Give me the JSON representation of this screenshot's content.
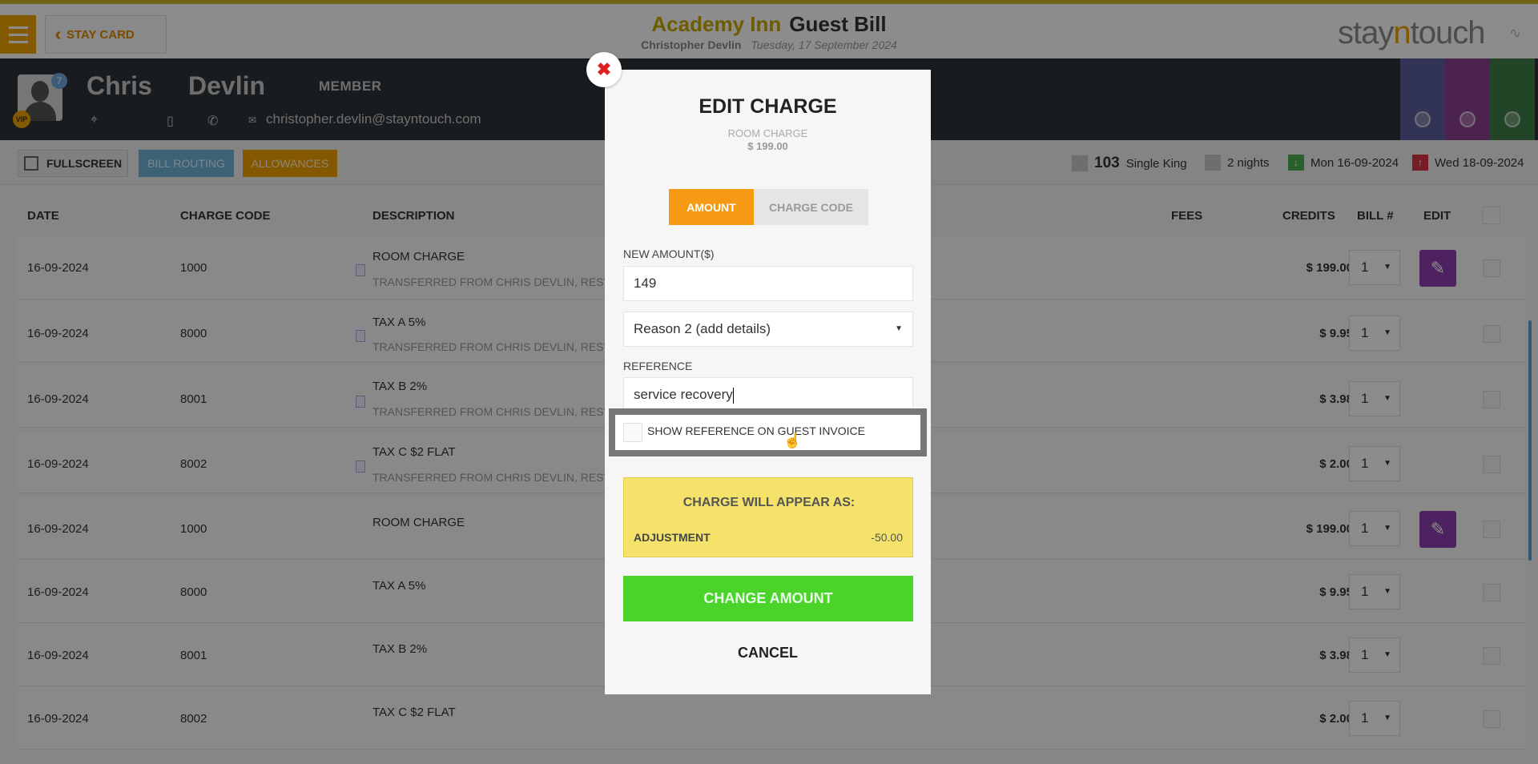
{
  "header": {
    "menu_icon": "hamburger-icon",
    "back_label": "STAY CARD",
    "hotel": "Academy Inn",
    "page": "Guest Bill",
    "guest_name": "Christopher Devlin",
    "date": "Tuesday, 17 September 2024",
    "brand_prefix": "stay",
    "brand_accent": "n",
    "brand_suffix": "touch",
    "accent_color": "#f0a500"
  },
  "guest": {
    "first_name": "Chris",
    "last_name": "Devlin",
    "status": "MEMBER",
    "avatar_badge": "7",
    "vip": "VIP",
    "email": "christopher.devlin@stayntouch.com"
  },
  "toolbar": {
    "fullscreen": "FULLSCREEN",
    "bill_routing": "BILL ROUTING",
    "allowances": "ALLOWANCES",
    "room_number": "103",
    "room_type": "Single King",
    "nights": "2 nights",
    "arrival": "Mon 16-09-2024",
    "departure": "Wed 18-09-2024"
  },
  "table": {
    "headers": {
      "date": "DATE",
      "charge_code": "CHARGE CODE",
      "description": "DESCRIPTION",
      "fees": "FEES",
      "credits": "CREDITS",
      "bill": "BILL #",
      "edit": "EDIT"
    },
    "rows": [
      {
        "date": "16-09-2024",
        "code": "1000",
        "desc": "ROOM CHARGE",
        "desc2": "TRANSFERRED FROM CHRIS DEVLIN, RESV #",
        "fees": "$ 199.00",
        "bill": "1"
      },
      {
        "date": "16-09-2024",
        "code": "8000",
        "desc": "TAX A 5%",
        "desc2": "TRANSFERRED FROM CHRIS DEVLIN, RESV #",
        "fees": "$ 9.95",
        "bill": "1"
      },
      {
        "date": "16-09-2024",
        "code": "8001",
        "desc": "TAX B 2%",
        "desc2": "TRANSFERRED FROM CHRIS DEVLIN, RESV #",
        "fees": "$ 3.98",
        "bill": "1"
      },
      {
        "date": "16-09-2024",
        "code": "8002",
        "desc": "TAX C $2 FLAT",
        "desc2": "TRANSFERRED FROM CHRIS DEVLIN, RESV #",
        "fees": "$ 2.00",
        "bill": "1"
      },
      {
        "date": "16-09-2024",
        "code": "1000",
        "desc": "ROOM CHARGE",
        "desc2": "",
        "fees": "$ 199.00",
        "bill": "1"
      },
      {
        "date": "16-09-2024",
        "code": "8000",
        "desc": "TAX A 5%",
        "desc2": "",
        "fees": "$ 9.95",
        "bill": "1"
      },
      {
        "date": "16-09-2024",
        "code": "8001",
        "desc": "TAX B 2%",
        "desc2": "",
        "fees": "$ 3.98",
        "bill": "1"
      },
      {
        "date": "16-09-2024",
        "code": "8002",
        "desc": "TAX C $2 FLAT",
        "desc2": "",
        "fees": "$ 2.00",
        "bill": "1"
      }
    ]
  },
  "modal": {
    "title": "EDIT CHARGE",
    "charge_name": "ROOM CHARGE",
    "charge_amount": "$ 199.00",
    "tab_amount": "AMOUNT",
    "tab_code": "CHARGE CODE",
    "new_amount_label": "NEW AMOUNT($)",
    "new_amount_value": "149",
    "reason_selected": "Reason 2 (add details)",
    "reference_label": "REFERENCE",
    "reference_value": "service recovery",
    "show_reference_label": "SHOW REFERENCE ON GUEST INVOICE",
    "appear_heading": "CHARGE WILL APPEAR AS:",
    "appear_label": "ADJUSTMENT",
    "appear_value": "-50.00",
    "change_button": "CHANGE AMOUNT",
    "cancel_button": "CANCEL"
  }
}
